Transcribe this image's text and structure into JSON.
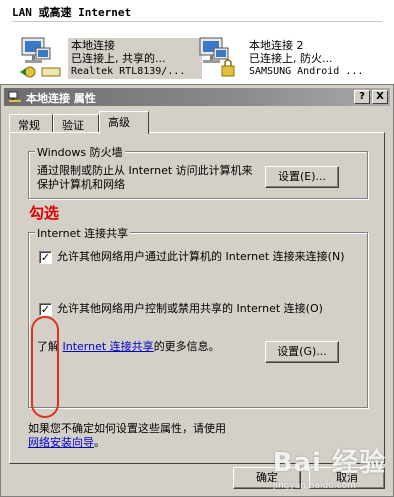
{
  "group": {
    "title": "LAN 或高速 Internet"
  },
  "connections": [
    {
      "name": "本地连接",
      "status": "已连接上, 共享的...",
      "device": "Realtek RTL8139/..."
    },
    {
      "name": "本地连接 2",
      "status": "已连接上, 防火...",
      "device": "SAMSUNG Android ..."
    }
  ],
  "dialog": {
    "title": "本地连接 属性",
    "help_label": "?",
    "close_label": "X",
    "tabs": [
      "常规",
      "验证",
      "高级"
    ],
    "active_tab": "高级",
    "firewall": {
      "title": "Windows 防火墙",
      "description": "通过限制或防止从 Internet 访问此计算机来保护计算机和网络",
      "settings_label": "设置(E)..."
    },
    "annotation": "勾选",
    "ics": {
      "title": "Internet 连接共享",
      "option1": {
        "label": "允许其他网络用户通过此计算机的 Internet 连接来连接(N)",
        "checked": true
      },
      "option2": {
        "label": "允许其他网络用户控制或禁用共享的 Internet 连接(O)",
        "checked": true
      },
      "learn_prefix": "了解",
      "learn_link": "Internet 连接共享",
      "learn_suffix": "的更多信息。",
      "settings_label": "设置(G)..."
    },
    "footer_text": "如果您不确定如何设置这些属性，请使用",
    "footer_link": "网络安装向导",
    "footer_suffix": "。",
    "ok_label": "确定",
    "cancel_label": "取消"
  },
  "watermark": {
    "brand": "Bai 经验",
    "url": "jingyan.baidu.com"
  },
  "colors": {
    "titlebar": "#7a7a7a",
    "dialog_bg": "#d4d0c8",
    "annotation": "#e00000",
    "link": "#0000cc"
  }
}
